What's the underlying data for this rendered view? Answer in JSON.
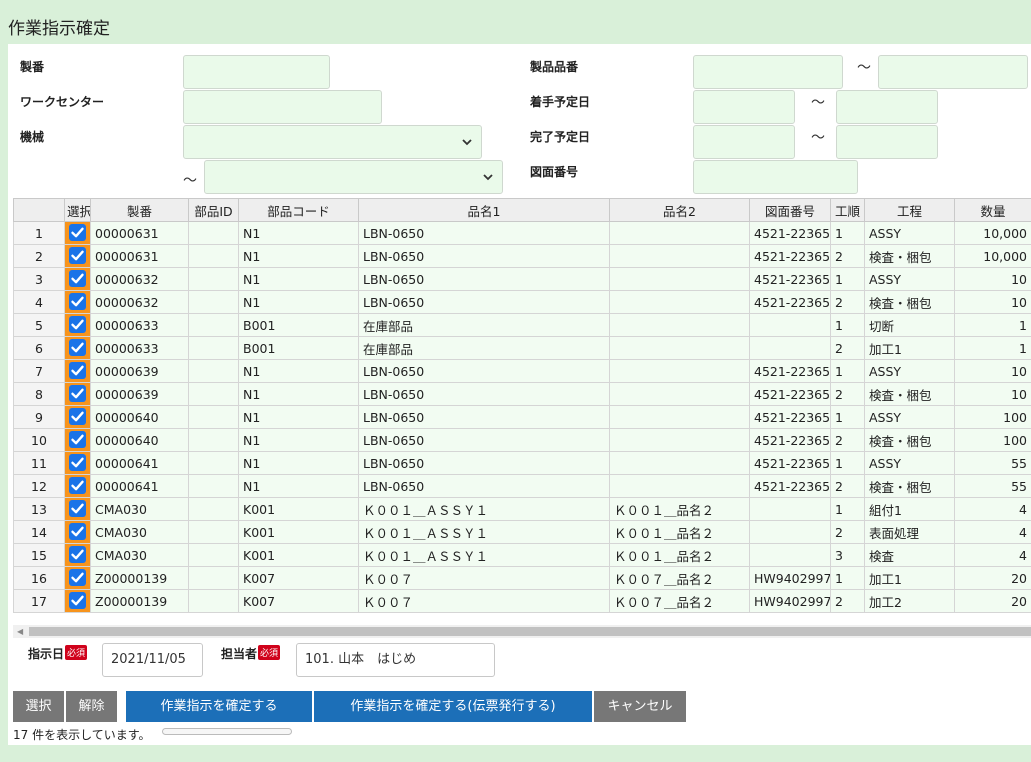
{
  "title": "作業指示確定",
  "filters": {
    "seiban_label": "製番",
    "workcenter_label": "ワークセンター",
    "machine_label": "機械",
    "product_no_label": "製品品番",
    "start_date_label": "着手予定日",
    "end_date_label": "完了予定日",
    "drawing_no_label": "図面番号",
    "tilde": "～"
  },
  "table": {
    "columns": [
      "",
      "選択",
      "製番",
      "部品ID",
      "部品コード",
      "品名1",
      "品名2",
      "図面番号",
      "工順",
      "工程",
      "数量"
    ],
    "rows": [
      [
        "1",
        "00000631",
        "",
        "N1",
        "LBN-0650",
        "",
        "4521-22365",
        "1",
        "ASSY",
        "10,000"
      ],
      [
        "2",
        "00000631",
        "",
        "N1",
        "LBN-0650",
        "",
        "4521-22365",
        "2",
        "検査・梱包",
        "10,000"
      ],
      [
        "3",
        "00000632",
        "",
        "N1",
        "LBN-0650",
        "",
        "4521-22365",
        "1",
        "ASSY",
        "10"
      ],
      [
        "4",
        "00000632",
        "",
        "N1",
        "LBN-0650",
        "",
        "4521-22365",
        "2",
        "検査・梱包",
        "10"
      ],
      [
        "5",
        "00000633",
        "",
        "B001",
        "在庫部品",
        "",
        "",
        "1",
        "切断",
        "1"
      ],
      [
        "6",
        "00000633",
        "",
        "B001",
        "在庫部品",
        "",
        "",
        "2",
        "加工1",
        "1"
      ],
      [
        "7",
        "00000639",
        "",
        "N1",
        "LBN-0650",
        "",
        "4521-22365",
        "1",
        "ASSY",
        "10"
      ],
      [
        "8",
        "00000639",
        "",
        "N1",
        "LBN-0650",
        "",
        "4521-22365",
        "2",
        "検査・梱包",
        "10"
      ],
      [
        "9",
        "00000640",
        "",
        "N1",
        "LBN-0650",
        "",
        "4521-22365",
        "1",
        "ASSY",
        "100"
      ],
      [
        "10",
        "00000640",
        "",
        "N1",
        "LBN-0650",
        "",
        "4521-22365",
        "2",
        "検査・梱包",
        "100"
      ],
      [
        "11",
        "00000641",
        "",
        "N1",
        "LBN-0650",
        "",
        "4521-22365",
        "1",
        "ASSY",
        "55"
      ],
      [
        "12",
        "00000641",
        "",
        "N1",
        "LBN-0650",
        "",
        "4521-22365",
        "2",
        "検査・梱包",
        "55"
      ],
      [
        "13",
        "CMA030",
        "",
        "K001",
        "Ｋ００１＿ＡＳＳＹ１",
        "Ｋ００１＿品名２",
        "",
        "1",
        "組付1",
        "4"
      ],
      [
        "14",
        "CMA030",
        "",
        "K001",
        "Ｋ００１＿ＡＳＳＹ１",
        "Ｋ００１＿品名２",
        "",
        "2",
        "表面処理",
        "4"
      ],
      [
        "15",
        "CMA030",
        "",
        "K001",
        "Ｋ００１＿ＡＳＳＹ１",
        "Ｋ００１＿品名２",
        "",
        "3",
        "検査",
        "4"
      ],
      [
        "16",
        "Z00000139",
        "",
        "K007",
        "Ｋ００７",
        "Ｋ００７＿品名２",
        "HW9402997-",
        "1",
        "加工1",
        "20"
      ],
      [
        "17",
        "Z00000139",
        "",
        "K007",
        "Ｋ００７",
        "Ｋ００７＿品名２",
        "HW9402997-",
        "2",
        "加工2",
        "20"
      ]
    ]
  },
  "bottom": {
    "date_label": "指示日",
    "date_value": "2021/11/05",
    "assignee_label": "担当者",
    "assignee_value": "101. 山本　はじめ",
    "required_badge": "必須"
  },
  "buttons": {
    "select": "選択",
    "deselect": "解除",
    "confirm": "作業指示を確定する",
    "confirm_slip": "作業指示を確定する(伝票発行する)",
    "cancel": "キャンセル"
  },
  "status_text": "17 件を表示しています。",
  "colors": {
    "background": "#d9f0d9",
    "row": "#f2fcf2",
    "checkbox_cell": "#f7941d",
    "checkbox": "#1a73e8",
    "blue_button": "#1c6fb8",
    "gray_button": "#777777",
    "required": "#d0021b"
  }
}
